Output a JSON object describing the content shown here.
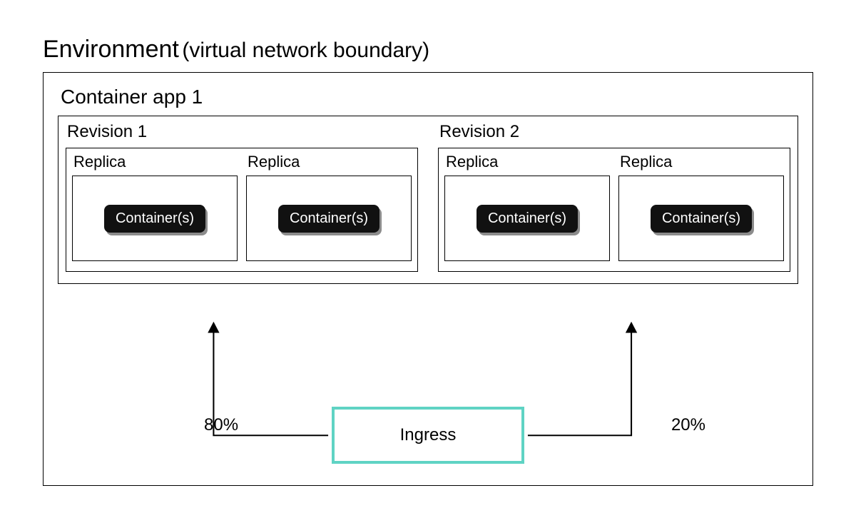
{
  "title": {
    "main": "Environment",
    "sub": "(virtual network boundary)"
  },
  "app": {
    "title": "Container app 1",
    "revisions": [
      {
        "label": "Revision 1",
        "replicas": [
          {
            "label": "Replica",
            "container_label": "Container(s)"
          },
          {
            "label": "Replica",
            "container_label": "Container(s)"
          }
        ]
      },
      {
        "label": "Revision 2",
        "replicas": [
          {
            "label": "Replica",
            "container_label": "Container(s)"
          },
          {
            "label": "Replica",
            "container_label": "Container(s)"
          }
        ]
      }
    ]
  },
  "ingress": {
    "label": "Ingress",
    "traffic": [
      {
        "target": "Revision 1",
        "percent": "80%"
      },
      {
        "target": "Revision 2",
        "percent": "20%"
      }
    ]
  },
  "colors": {
    "ingress_border": "#5fd3c4",
    "container_bg": "#111111"
  }
}
